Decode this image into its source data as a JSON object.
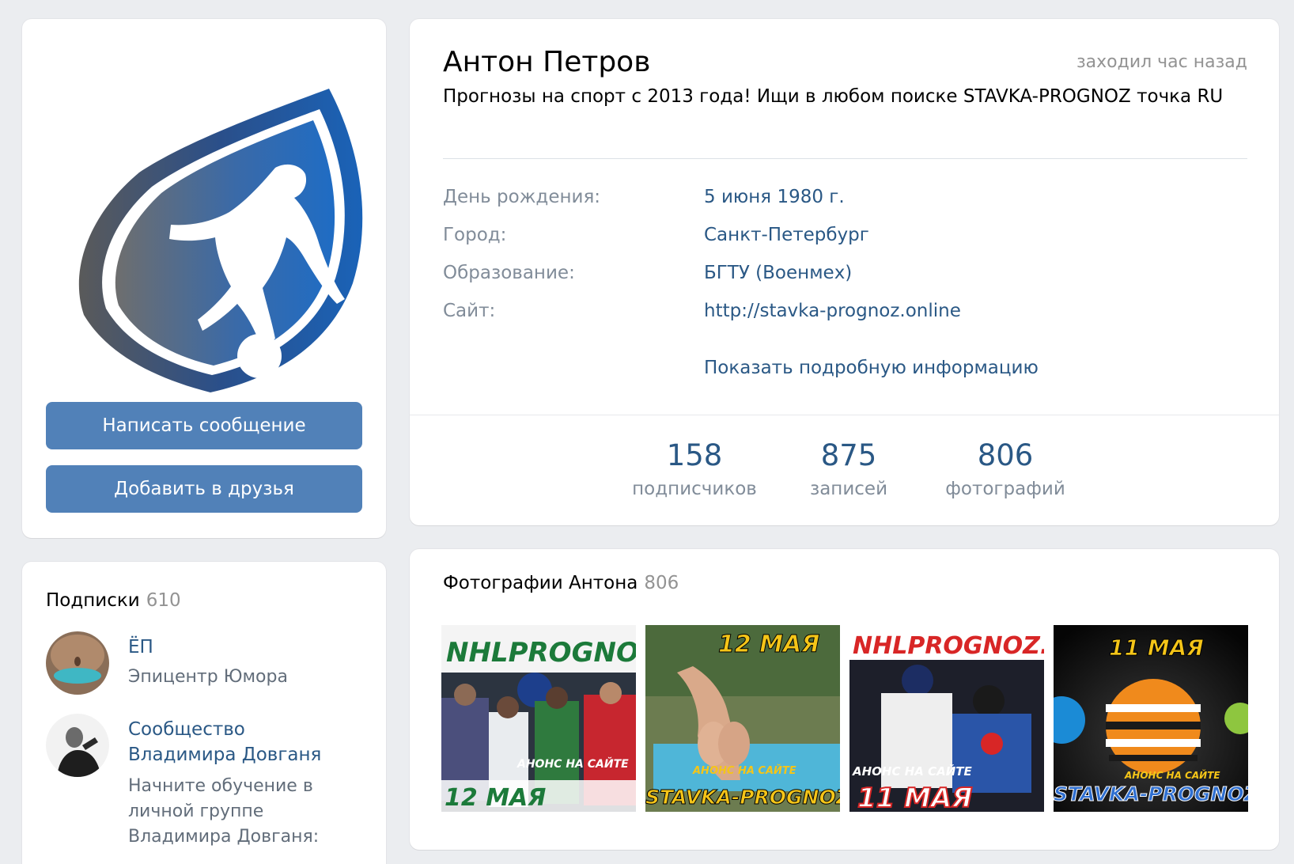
{
  "profile": {
    "name": "Антон Петров",
    "last_seen": "заходил час назад",
    "status": "Прогнозы на спорт с 2013 года! Ищи в любом поиске STAVKA-PROGNOZ точка RU"
  },
  "actions": {
    "message_label": "Написать сообщение",
    "add_friend_label": "Добавить в друзья"
  },
  "info": {
    "birthday": {
      "label": "День рождения:",
      "value": "5 июня 1980 г."
    },
    "city": {
      "label": "Город:",
      "value": "Санкт-Петербург"
    },
    "education": {
      "label": "Образование:",
      "value": "БГТУ (Военмех)"
    },
    "site": {
      "label": "Сайт:",
      "value": "http://stavka-prognoz.online"
    },
    "show_more_label": "Показать подробную информацию"
  },
  "counters": {
    "followers": {
      "value": "158",
      "label": "подписчиков"
    },
    "posts": {
      "value": "875",
      "label": "записей"
    },
    "photos": {
      "value": "806",
      "label": "фотографий"
    }
  },
  "subscriptions": {
    "title": "Подписки",
    "count": "610",
    "items": [
      {
        "name": "ЁП",
        "description": "Эпицентр Юмора"
      },
      {
        "name": "Сообщество Владимира Довганя",
        "description": "Начните обучение в личной группе Владимира Довганя:"
      }
    ]
  },
  "photos": {
    "title": "Фотографии Антона",
    "count": "806",
    "items": [
      {
        "top_text": "NHLPROGNOZ.RU",
        "mid_text": "АНОНС НА САЙТЕ",
        "bottom_text": "12 МАЯ"
      },
      {
        "top_text": "12 МАЯ",
        "mid_text": "АНОНС НА САЙТЕ",
        "bottom_text": "STAVKA-PROGNOZ.RU"
      },
      {
        "top_text": "NHLPROGNOZ.RU",
        "mid_text": "АНОНС НА САЙТЕ",
        "bottom_text": "11 МАЯ"
      },
      {
        "top_text": "11 МАЯ",
        "mid_text": "АНОНС НА САЙТЕ",
        "bottom_text": "STAVKA-PROGNOZ.RU"
      }
    ]
  },
  "colors": {
    "accent": "#5181b8",
    "link": "#2a5885",
    "muted": "#818c99",
    "background": "#ebedf0"
  }
}
